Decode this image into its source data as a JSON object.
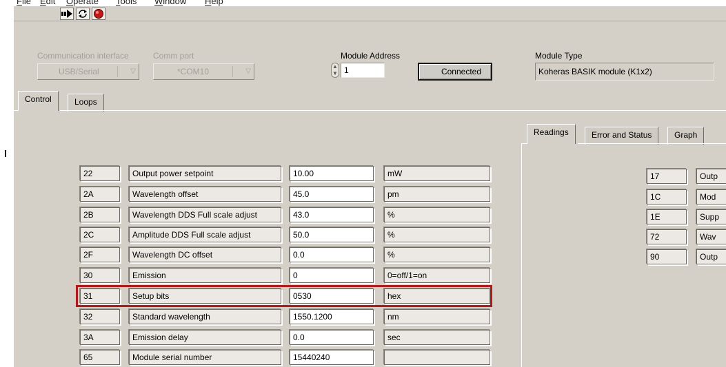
{
  "menu": [
    "File",
    "Edit",
    "Operate",
    "Tools",
    "Window",
    "Help"
  ],
  "toolbar": {
    "run_icon": "run-arrow-icon",
    "run_continuous_icon": "run-continuously-icon",
    "abort_icon": "abort-stop-icon"
  },
  "connection": {
    "interface_label": "Communication interface",
    "interface_value": "USB/Serial",
    "port_label": "Comm port",
    "port_value": "*COM10",
    "address_label": "Module Address",
    "address_value": "1",
    "status_button": "Connected",
    "type_label": "Module Type",
    "type_value": "Koheras BASIK module (K1x2)"
  },
  "main_tabs": [
    {
      "label": "Control",
      "active": true
    },
    {
      "label": "Loops",
      "active": false
    }
  ],
  "side_tabs": [
    {
      "label": "Readings",
      "active": true
    },
    {
      "label": "Error and Status",
      "active": false
    },
    {
      "label": "Graph",
      "active": false
    }
  ],
  "control_rows": [
    {
      "reg": "22",
      "name": "Output power setpoint",
      "value": "10.00",
      "unit": "mW"
    },
    {
      "reg": "2A",
      "name": "Wavelength offset",
      "value": "45.0",
      "unit": "pm"
    },
    {
      "reg": "2B",
      "name": "Wavelength DDS Full scale adjust",
      "value": "43.0",
      "unit": "%"
    },
    {
      "reg": "2C",
      "name": "Amplitude DDS Full scale adjust",
      "value": "50.0",
      "unit": "%"
    },
    {
      "reg": "2F",
      "name": "Wavelength DC offset",
      "value": "0.0",
      "unit": "%"
    },
    {
      "reg": "30",
      "name": "Emission",
      "value": "0",
      "unit": "0=off/1=on"
    },
    {
      "reg": "31",
      "name": "Setup bits",
      "value": "0530",
      "unit": "hex",
      "highlighted": true
    },
    {
      "reg": "32",
      "name": "Standard wavelength",
      "value": "1550.1200",
      "unit": "nm"
    },
    {
      "reg": "3A",
      "name": "Emission delay",
      "value": "0.0",
      "unit": "sec"
    },
    {
      "reg": "65",
      "name": "Module serial number",
      "value": "15440240",
      "unit": ""
    }
  ],
  "reading_rows": [
    {
      "reg": "17",
      "name": "Outp"
    },
    {
      "reg": "1C",
      "name": "Mod"
    },
    {
      "reg": "1E",
      "name": "Supp"
    },
    {
      "reg": "72",
      "name": "Wav"
    },
    {
      "reg": "90",
      "name": "Outp"
    }
  ],
  "colors": {
    "panel": "#d4d0c8",
    "highlight": "#b11a1a"
  }
}
